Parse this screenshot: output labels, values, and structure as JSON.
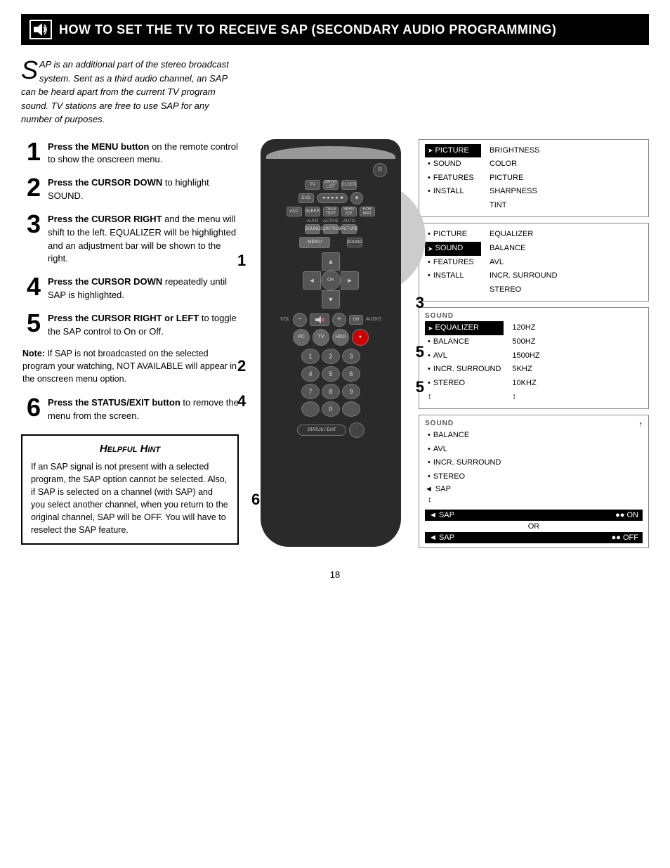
{
  "header": {
    "title": "How to Set the TV to Receive SAP (Secondary Audio Programming)",
    "icon_label": "sound-icon"
  },
  "intro": {
    "drop_cap": "S",
    "text": "AP is an additional part of the stereo broadcast system.  Sent as a third audio channel, an SAP can be heard apart from the current TV program sound.  TV stations are free to use SAP for any number of purposes."
  },
  "steps": [
    {
      "number": "1",
      "text_parts": [
        {
          "bold": true,
          "text": "Press the MENU button"
        },
        {
          "bold": false,
          "text": " on the remote control to show the onscreen menu."
        }
      ]
    },
    {
      "number": "2",
      "text_parts": [
        {
          "bold": true,
          "text": "Press the CURSOR DOWN"
        },
        {
          "bold": false,
          "text": " to highlight SOUND."
        }
      ]
    },
    {
      "number": "3",
      "text_parts": [
        {
          "bold": true,
          "text": "Press the CURSOR RIGHT"
        },
        {
          "bold": false,
          "text": " and the menu will shift to the left. EQUALIZER will be highlighted and an adjustment bar will be shown to the right."
        }
      ]
    },
    {
      "number": "4",
      "text_parts": [
        {
          "bold": true,
          "text": "Press the CURSOR DOWN"
        },
        {
          "bold": false,
          "text": " repeatedly until SAP is highlighted."
        }
      ]
    },
    {
      "number": "5",
      "text_parts": [
        {
          "bold": true,
          "text": "Press the CURSOR RIGHT or LEFT"
        },
        {
          "bold": false,
          "text": " to toggle the SAP control to On or Off."
        }
      ]
    }
  ],
  "note": {
    "label": "Note:",
    "text": "If SAP is not broadcasted on the selected program your watching, NOT AVAILABLE will appear in the onscreen menu option."
  },
  "step6": {
    "number": "6",
    "text_parts": [
      {
        "bold": true,
        "text": "Press the STATUS/EXIT button"
      },
      {
        "bold": false,
        "text": " to remove the menu from the screen."
      }
    ]
  },
  "hint": {
    "title": "Helpful Hint",
    "text": "If an SAP signal is not present with a selected program, the SAP option cannot be selected.  Also, if SAP is selected on a channel (with SAP) and you select another channel, when you return to the original channel, SAP will be OFF.  You will have to reselect the SAP feature."
  },
  "menu1": {
    "items_left": [
      {
        "label": "PICTURE",
        "highlighted": true,
        "arrow": true
      },
      {
        "label": "SOUND",
        "dot": true
      },
      {
        "label": "FEATURES",
        "dot": true
      },
      {
        "label": "INSTALL",
        "dot": true
      }
    ],
    "items_right": [
      {
        "label": "BRIGHTNESS"
      },
      {
        "label": "COLOR"
      },
      {
        "label": "PICTURE"
      },
      {
        "label": "SHARPNESS"
      },
      {
        "label": "TINT"
      }
    ]
  },
  "menu2": {
    "items_left": [
      {
        "label": "PICTURE",
        "dot": true
      },
      {
        "label": "SOUND",
        "highlighted": true,
        "arrow": true
      },
      {
        "label": "FEATURES",
        "dot": true
      },
      {
        "label": "INSTALL",
        "dot": true
      }
    ],
    "items_right": [
      {
        "label": "EQUALIZER"
      },
      {
        "label": "BALANCE"
      },
      {
        "label": "AVL"
      },
      {
        "label": "INCR. SURROUND"
      },
      {
        "label": "STEREO"
      }
    ]
  },
  "menu3": {
    "title": "SOUND",
    "items": [
      {
        "label": "EQUALIZER",
        "highlighted": true,
        "arrow": true
      },
      {
        "label": "BALANCE",
        "dot": true
      },
      {
        "label": "AVL",
        "dot": true
      },
      {
        "label": "INCR. SURROUND",
        "dot": true
      },
      {
        "label": "STEREO",
        "dot": true
      },
      {
        "label": "↕",
        "special": true
      }
    ],
    "items_right": [
      {
        "label": "120HZ"
      },
      {
        "label": "500HZ"
      },
      {
        "label": "1500HZ"
      },
      {
        "label": "5KHZ"
      },
      {
        "label": "10KHZ"
      },
      {
        "label": "↕"
      }
    ]
  },
  "menu4": {
    "title": "SOUND",
    "title_icon": "↑",
    "items": [
      {
        "label": "BALANCE",
        "dot": true
      },
      {
        "label": "AVL",
        "dot": true
      },
      {
        "label": "INCR. SURROUND",
        "dot": true
      },
      {
        "label": "STEREO",
        "dot": true
      },
      {
        "label": "SAP",
        "sap_on": true
      },
      {
        "label": "↕",
        "special": true
      }
    ],
    "sap_on_label": "◄ SAP",
    "sap_on_value": "●● ON",
    "or_label": "OR",
    "sap_off_label": "◄ SAP",
    "sap_off_value": "●● OFF"
  },
  "remote": {
    "step_labels": [
      "1",
      "2",
      "4",
      "5",
      "3",
      "5",
      "6"
    ],
    "power_symbol": "⏻",
    "dpad": {
      "up": "▲",
      "down": "▼",
      "left": "◄",
      "right": "►",
      "center": "OK"
    },
    "numpad": [
      "1",
      "2",
      "3",
      "4",
      "5",
      "6",
      "7",
      "8",
      "9",
      "0"
    ]
  },
  "page_number": "18"
}
